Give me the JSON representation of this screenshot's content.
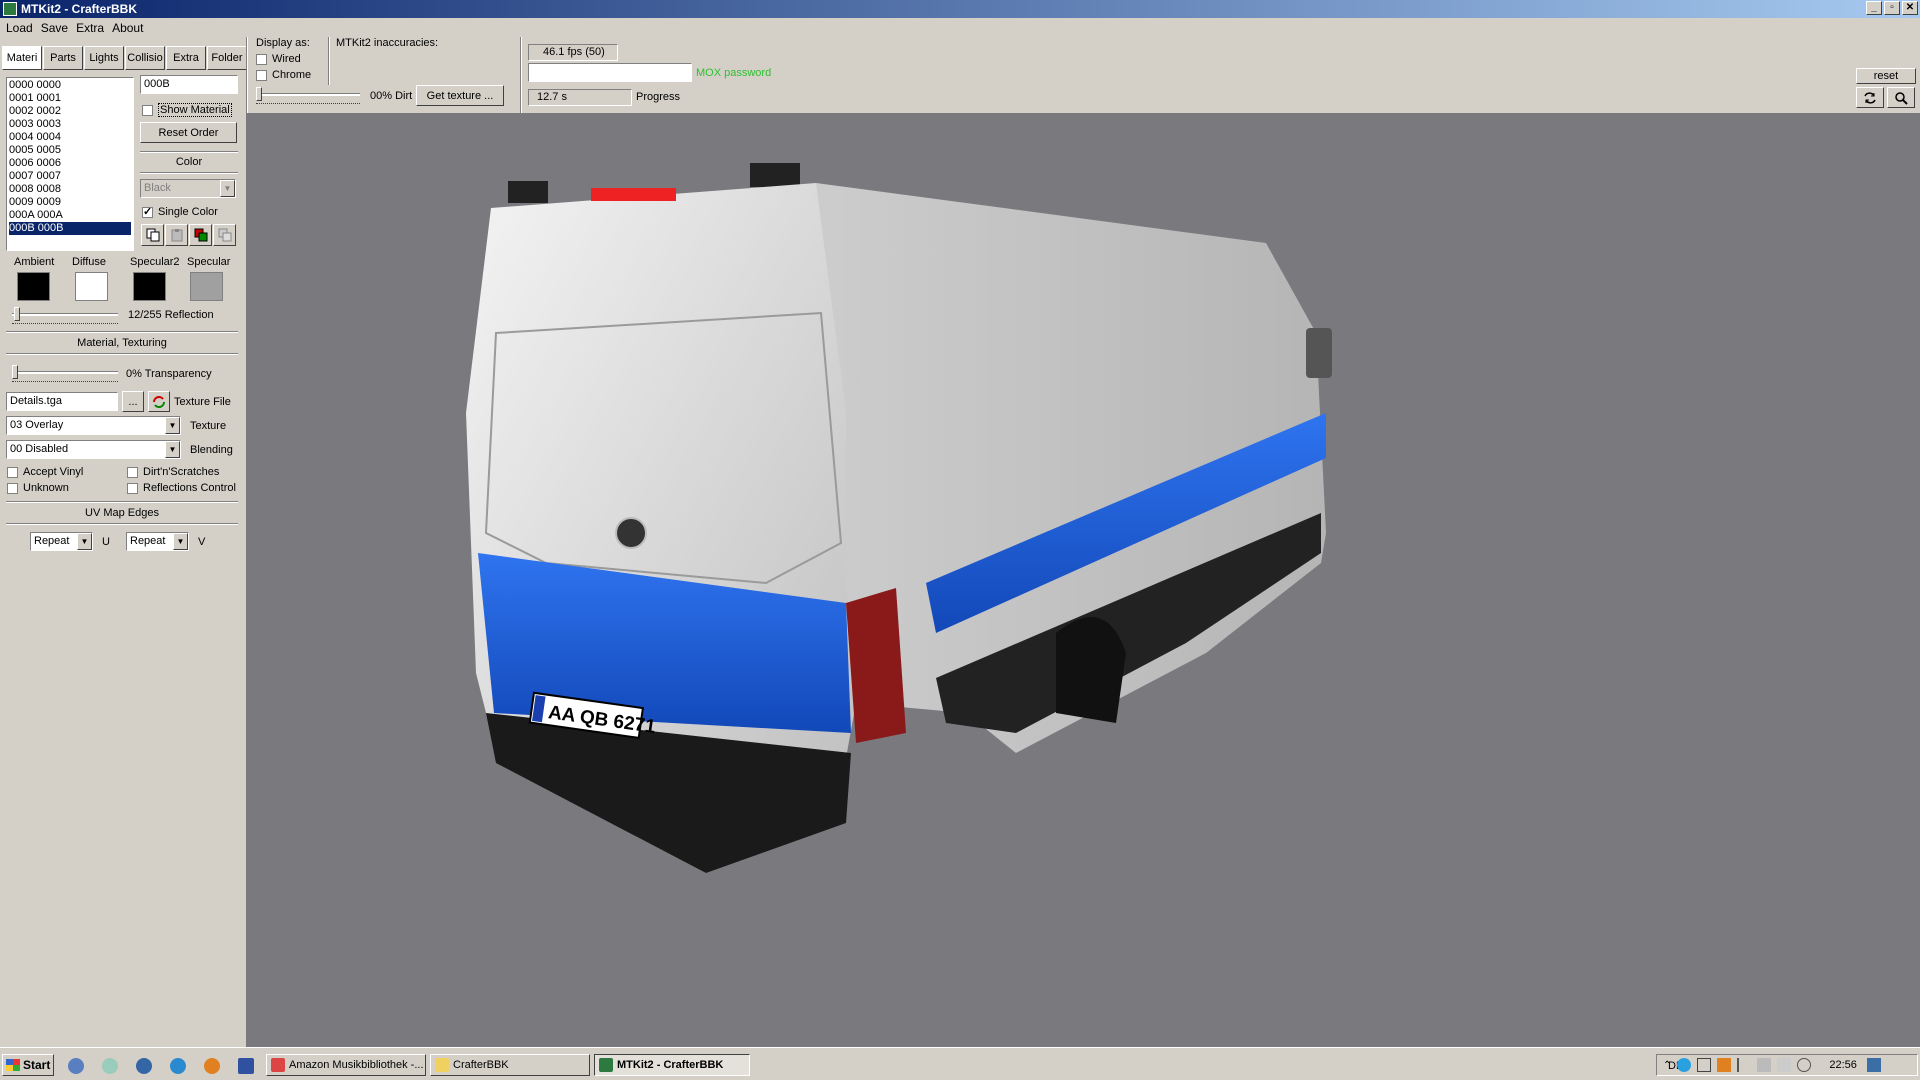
{
  "window": {
    "title": "MTKit2 - CrafterBBK",
    "minimize": "_",
    "maximize": "▫",
    "close": "✕"
  },
  "menu": [
    "Load",
    "Save",
    "Extra",
    "About"
  ],
  "tabs": [
    "Materi",
    "Parts",
    "Lights",
    "Collisio",
    "Extra",
    "Folder"
  ],
  "materials": {
    "items": [
      "0000 0000",
      "0001 0001",
      "0002 0002",
      "0003 0003",
      "0004 0004",
      "0005 0005",
      "0006 0006",
      "0007 0007",
      "0008 0008",
      "0009 0009",
      "000A 000A",
      "000B 000B"
    ],
    "selected": "000B 000B",
    "name_value": "000B",
    "show_material": "Show Material",
    "reset_order": "Reset Order",
    "color_header": "Color",
    "color_value": "Black",
    "single_color": "Single Color",
    "single_color_checked": true,
    "swatches": [
      {
        "label": "Ambient",
        "color": "#000000"
      },
      {
        "label": "Diffuse",
        "color": "#ffffff"
      },
      {
        "label": "Specular2",
        "color": "#000000"
      },
      {
        "label": "Specular",
        "color": "#a0a0a0"
      }
    ],
    "reflection_label": "12/255 Reflection",
    "reflection_value": 12,
    "material_texturing_header": "Material, Texturing",
    "transparency_label": "0% Transparency",
    "transparency_value": 0,
    "texture_file_value": "Details.tga",
    "texture_file_browse": "...",
    "texture_file_label": "Texture File",
    "texture_value": "03 Overlay",
    "texture_label": "Texture",
    "blending_value": "00 Disabled",
    "blending_label": "Blending",
    "accept_vinyl": "Accept Vinyl",
    "dirt_scratches": "Dirt'n'Scratches",
    "unknown": "Unknown",
    "reflections_control": "Reflections Control",
    "uv_header": "UV Map Edges",
    "uv_u_value": "Repeat",
    "uv_u_label": "U",
    "uv_v_value": "Repeat",
    "uv_v_label": "V"
  },
  "toolbar": {
    "display_as": "Display as:",
    "wired": "Wired",
    "chrome": "Chrome",
    "dirt_label": "00% Dirt",
    "dirt_value": 0,
    "get_texture": "Get texture ...",
    "inaccuracies": "MTKit2 inaccuracies:",
    "fps": "46.1 fps (50)",
    "mox_password": "MOX password",
    "time": "12.7 s",
    "progress": "Progress",
    "reset": "reset"
  },
  "viewport": {
    "plate": "AA QB 6271",
    "colors": {
      "background": "#7a7a7e",
      "body": "#e8e8e8",
      "stripe": "#1a5fd6"
    }
  },
  "taskbar": {
    "start": "Start",
    "tasks": [
      {
        "label": "Amazon Musikbibliothek -...",
        "active": false
      },
      {
        "label": "CrafterBBK",
        "active": false
      },
      {
        "label": "MTKit2 - CrafterBBK",
        "active": true
      }
    ],
    "lang": "DE",
    "clock": "22:56"
  }
}
